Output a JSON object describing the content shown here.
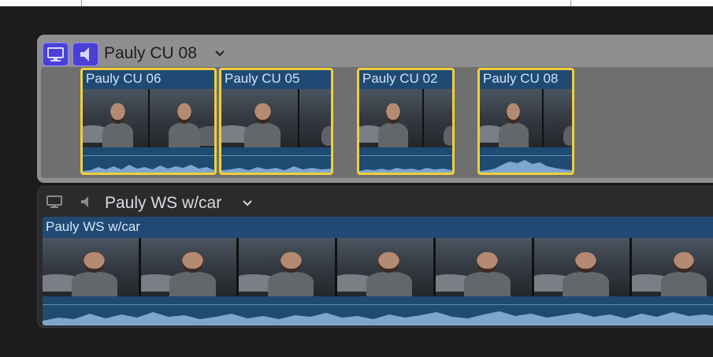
{
  "audition": {
    "title": "Pauly CU 08",
    "icons": [
      "video-monitor-icon",
      "speaker-icon",
      "chevron-down-icon"
    ],
    "accent_color": "#4a3fd6",
    "clips": [
      {
        "title": "Pauly CU 06",
        "selected": true
      },
      {
        "title": "Pauly CU 05",
        "selected": true
      },
      {
        "title": "Pauly CU 02",
        "selected": true
      },
      {
        "title": "Pauly CU 08",
        "selected": true
      }
    ],
    "selection_color": "#f0cf3a"
  },
  "storyline": {
    "title": "Pauly WS w/car",
    "icons": [
      "video-monitor-icon",
      "speaker-icon",
      "chevron-down-icon"
    ],
    "clip": {
      "title": "Pauly WS w/car"
    }
  },
  "colors": {
    "clip_blue": "#204a73",
    "background": "#1c1c1e"
  }
}
